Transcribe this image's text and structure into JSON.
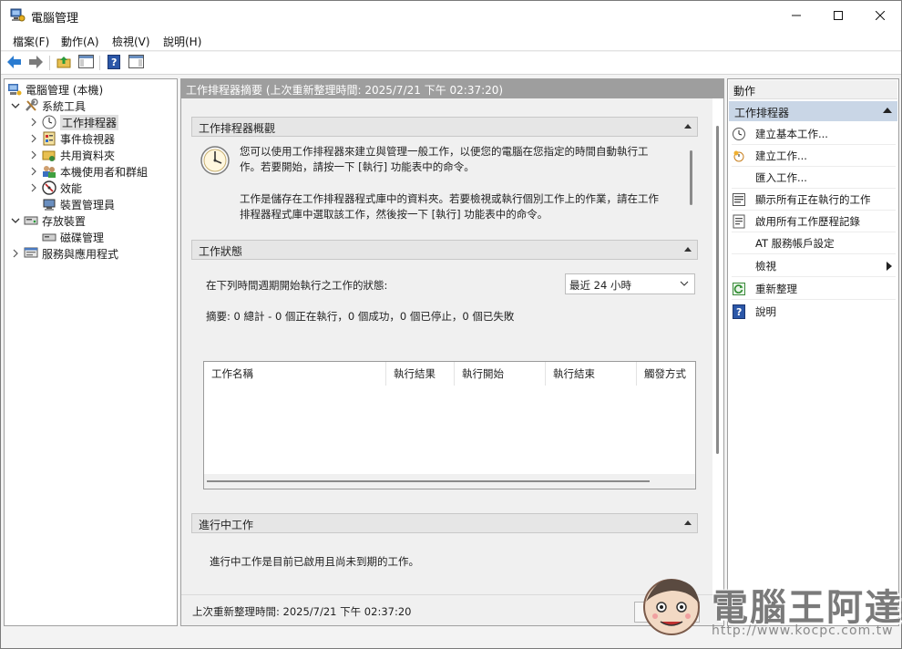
{
  "window": {
    "title": "電腦管理"
  },
  "menubar": {
    "items": [
      "檔案(F)",
      "動作(A)",
      "檢視(V)",
      "說明(H)"
    ]
  },
  "toolbar": {
    "buttons": [
      "back-icon",
      "forward-icon",
      "up-folder-icon",
      "show-hide-console-tree-icon",
      "help-icon",
      "show-hide-action-pane-icon"
    ]
  },
  "tree": {
    "root": "電腦管理 (本機)",
    "system_tools": "系統工具",
    "task_scheduler": "工作排程器",
    "event_viewer": "事件檢視器",
    "shared_folders": "共用資料夾",
    "local_users": "本機使用者和群組",
    "performance": "效能",
    "device_manager": "裝置管理員",
    "storage": "存放裝置",
    "disk_management": "磁碟管理",
    "services_apps": "服務與應用程式"
  },
  "main": {
    "header": "工作排程器摘要 (上次重新整理時間: 2025/7/21 下午 02:37:20)",
    "overview": {
      "title": "工作排程器概觀",
      "para1": "您可以使用工作排程器來建立與管理一般工作，以便您的電腦在您指定的時間自動執行工作。若要開始，請按一下 [執行] 功能表中的命令。",
      "para2": "工作是儲存在工作排程器程式庫中的資料夾。若要檢視或執行個別工作上的作業，請在工作排程器程式庫中選取該工作，然後按一下 [執行] 功能表中的命令。"
    },
    "status": {
      "title": "工作狀態",
      "period_label": "在下列時間週期開始執行之工作的狀態:",
      "period_value": "最近 24 小時",
      "summary": "摘要: 0 總計 - 0 個正在執行，0 個成功，0 個已停止，0 個已失敗",
      "columns": [
        "工作名稱",
        "執行結果",
        "執行開始",
        "執行結束",
        "觸發方式"
      ]
    },
    "running": {
      "title": "進行中工作",
      "text": "進行中工作是目前已啟用且尚未到期的工作。"
    },
    "footer": {
      "last_refresh": "上次重新整理時間: 2025/7/21 下午 02:37:20",
      "refresh_button": "重新整理"
    }
  },
  "actions": {
    "title": "動作",
    "group": "工作排程器",
    "items": [
      "建立基本工作...",
      "建立工作...",
      "匯入工作...",
      "顯示所有正在執行的工作",
      "啟用所有工作歷程記錄",
      "AT 服務帳戶設定",
      "檢視",
      "重新整理",
      "說明"
    ]
  },
  "watermark": {
    "brand": "電腦王阿達",
    "url": "http://www.kocpc.com.tw"
  }
}
